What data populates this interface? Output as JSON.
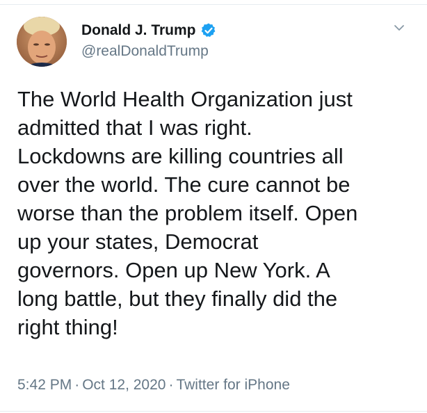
{
  "tweet": {
    "author": {
      "display_name": "Donald J. Trump",
      "handle": "@realDonaldTrump",
      "verified": true,
      "verified_icon": "verified-badge-icon",
      "avatar": "profile-photo"
    },
    "menu_icon": "chevron-down-icon",
    "text_lines": [
      "The World Health Organization just",
      "admitted that I was right.",
      "Lockdowns are killing countries all",
      "over the world. The cure cannot be",
      "worse than the problem itself. Open",
      "up your states, Democrat",
      "governors. Open up New York. A",
      "long battle, but they finally did the",
      "right thing!"
    ],
    "time": "5:42 PM",
    "date": "Oct 12, 2020",
    "separator": "·",
    "source": "Twitter for iPhone"
  },
  "colors": {
    "text": "#14171a",
    "secondary_text": "#657786",
    "verified_blue": "#1da1f2",
    "divider": "#e6ecf0"
  }
}
